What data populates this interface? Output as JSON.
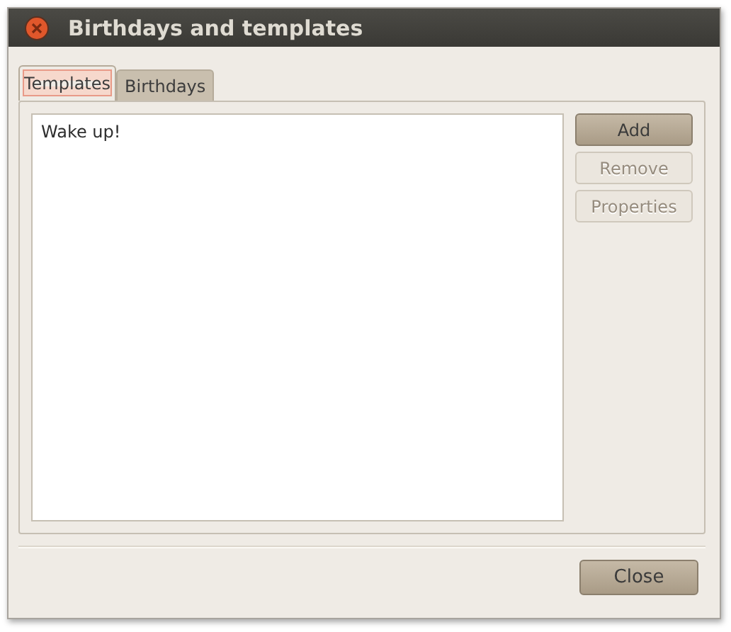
{
  "window": {
    "title": "Birthdays and templates"
  },
  "tabs": [
    {
      "label": "Templates",
      "selected": true
    },
    {
      "label": "Birthdays",
      "selected": false
    }
  ],
  "list": {
    "items": [
      "Wake up!"
    ]
  },
  "buttons": [
    {
      "label": "Add",
      "disabled": false
    },
    {
      "label": "Remove",
      "disabled": true
    },
    {
      "label": "Properties",
      "disabled": true
    }
  ],
  "footer_buttons": [
    {
      "label": "Close",
      "disabled": false
    }
  ]
}
